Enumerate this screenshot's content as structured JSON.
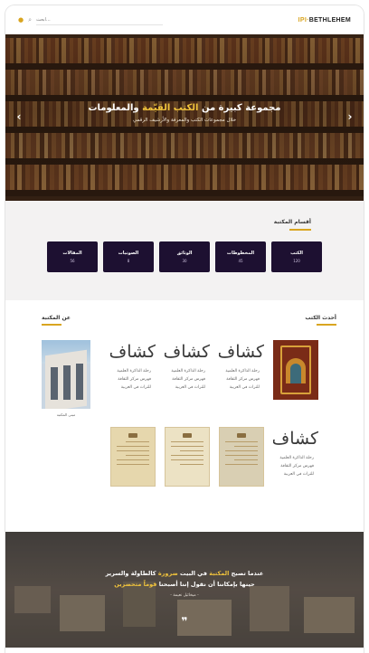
{
  "header": {
    "logo_prefix": "IPI",
    "logo_sep": "·",
    "logo_name": "BETHLEHEM",
    "search_placeholder": "ابحث..."
  },
  "hero": {
    "title_start": "مجموعة كبيرة من ",
    "title_highlight": "الكتب القيّمة",
    "title_end": " والمعلومات",
    "subtitle": "خلال مجموعات الكتب والمعرفة والأرشيف الرقمي"
  },
  "sections": {
    "title": "أقسام المكتبة",
    "cards": [
      {
        "label": "الكتب",
        "count": "120"
      },
      {
        "label": "المخطوطات",
        "count": "45"
      },
      {
        "label": "الوثائق",
        "count": "30"
      },
      {
        "label": "الصوتيات",
        "count": "8"
      },
      {
        "label": "المقالات",
        "count": "56"
      }
    ]
  },
  "latest": {
    "title": "أحدث الكتب",
    "about_title": "عن المكتبة",
    "calli_word": "كشاف",
    "calli_lines": [
      "رحلة الذاكرة العلمية",
      "فهرس مركز الثقافة",
      "للتراث في العربية"
    ],
    "photo_caption": "مبنى المكتبة"
  },
  "quote": {
    "line1_start": "عندما تصبح ",
    "line1_hl1": "المكتبة",
    "line1_mid": " في البيت ",
    "line1_hl2": "ضرورة",
    "line1_end": " كالطاولة والسرير",
    "line2_start": "حينها بإمكاننا أن نقول إننا أصبحنا ",
    "line2_hl": "قوماً متحضرين",
    "author": "- ميخائيل نعيمة -",
    "mark": "❞"
  },
  "colors": {
    "accent": "#d9a520",
    "card_bg": "#1d1031",
    "section_bg": "#f3f2f2"
  }
}
